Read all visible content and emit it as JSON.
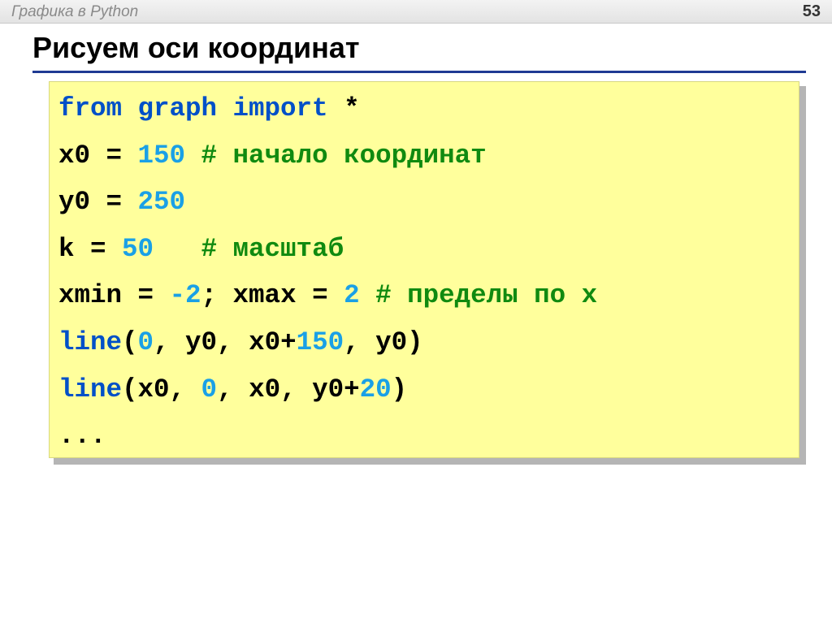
{
  "header": {
    "section": "Графика в Python",
    "page_number": "53"
  },
  "title": "Рисуем оси координат",
  "colors": {
    "keyword": "#0050c8",
    "number": "#1aa0e6",
    "comment": "#108a10",
    "code_background": "#ffff9c",
    "title_rule": "#1f3a93"
  },
  "code": {
    "lines": [
      [
        {
          "text": "from graph import",
          "kind": "kw"
        },
        {
          "text": " *",
          "kind": "code"
        }
      ],
      [
        {
          "text": "x0 = ",
          "kind": "code"
        },
        {
          "text": "150",
          "kind": "num"
        },
        {
          "text": " # начало координат",
          "kind": "cm"
        }
      ],
      [
        {
          "text": "y0 = ",
          "kind": "code"
        },
        {
          "text": "250",
          "kind": "num"
        }
      ],
      [
        {
          "text": "k = ",
          "kind": "code"
        },
        {
          "text": "50",
          "kind": "num"
        },
        {
          "text": "   # масштаб",
          "kind": "cm"
        }
      ],
      [
        {
          "text": "xmin = ",
          "kind": "code"
        },
        {
          "text": "-2",
          "kind": "num"
        },
        {
          "text": "; xmax = ",
          "kind": "code"
        },
        {
          "text": "2",
          "kind": "num"
        },
        {
          "text": " # пределы по x",
          "kind": "cm"
        }
      ],
      [
        {
          "text": "line",
          "kind": "kw"
        },
        {
          "text": "(",
          "kind": "code"
        },
        {
          "text": "0",
          "kind": "num"
        },
        {
          "text": ", y0, x0+",
          "kind": "code"
        },
        {
          "text": "150",
          "kind": "num"
        },
        {
          "text": ", y0)",
          "kind": "code"
        }
      ],
      [
        {
          "text": "line",
          "kind": "kw"
        },
        {
          "text": "(x0, ",
          "kind": "code"
        },
        {
          "text": "0",
          "kind": "num"
        },
        {
          "text": ", x0, y0+",
          "kind": "code"
        },
        {
          "text": "20",
          "kind": "num"
        },
        {
          "text": ")",
          "kind": "code"
        }
      ],
      [
        {
          "text": "...",
          "kind": "code"
        }
      ]
    ]
  }
}
